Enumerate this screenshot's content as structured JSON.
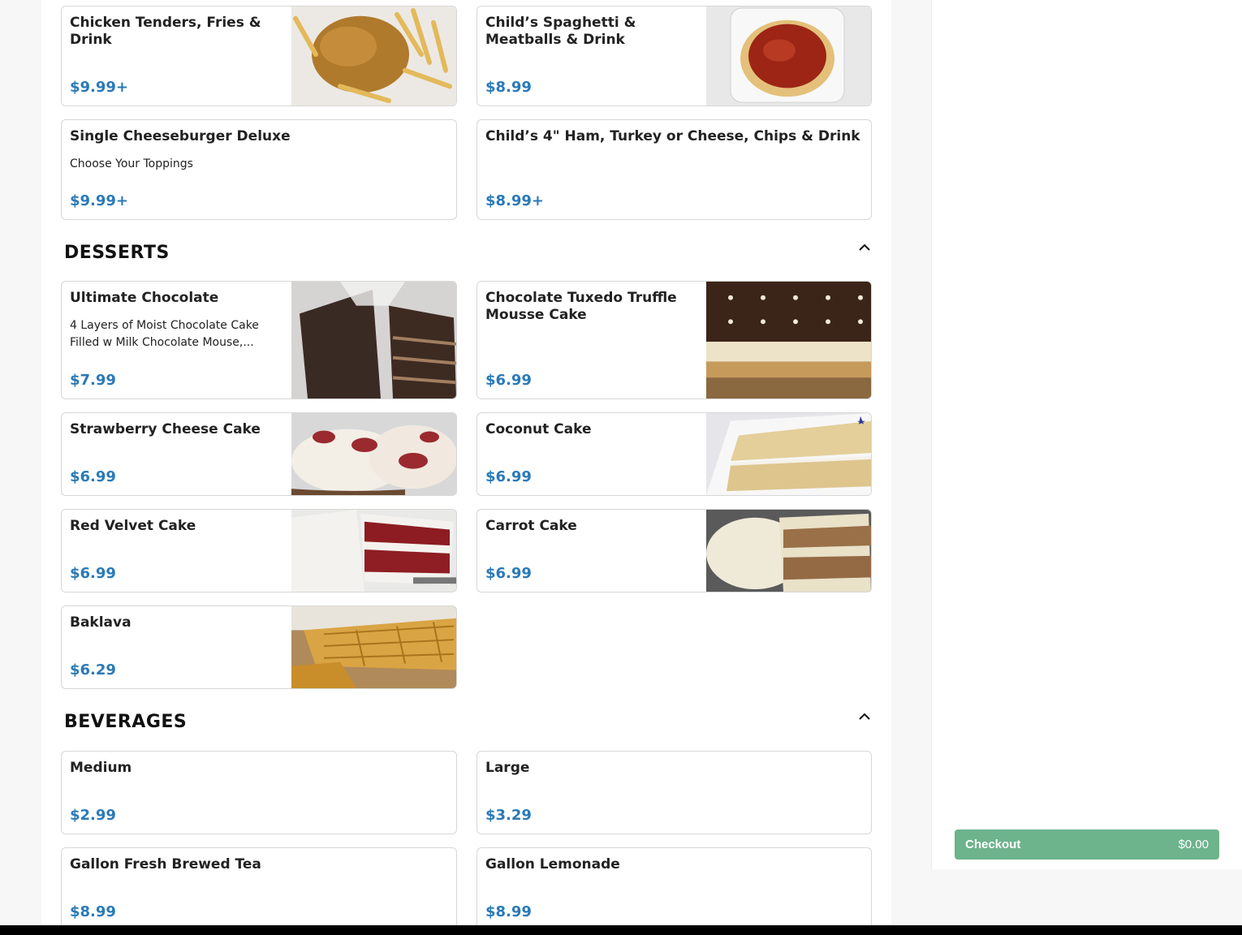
{
  "menu": {
    "kids_items": [
      {
        "name": "Chicken Tenders, Fries & Drink",
        "price": "$9.99+"
      },
      {
        "name": "Child’s Spaghetti & Meatballs & Drink",
        "price": "$8.99"
      },
      {
        "name": "Single Cheeseburger Deluxe",
        "description": "Choose Your Toppings",
        "price": "$9.99+"
      },
      {
        "name": "Child’s 4\" Ham, Turkey or Cheese, Chips & Drink",
        "price": "$8.99+"
      }
    ],
    "desserts": {
      "title": "DESSERTS",
      "items": [
        {
          "name": "Ultimate Chocolate",
          "description": "4 Layers of Moist Chocolate Cake Filled w Milk Chocolate Mouse,...",
          "price": "$7.99"
        },
        {
          "name": "Chocolate Tuxedo Truffle Mousse Cake",
          "price": "$6.99"
        },
        {
          "name": "Strawberry Cheese Cake",
          "price": "$6.99"
        },
        {
          "name": "Coconut Cake",
          "price": "$6.99"
        },
        {
          "name": "Red Velvet Cake",
          "price": "$6.99"
        },
        {
          "name": "Carrot Cake",
          "price": "$6.99"
        },
        {
          "name": "Baklava",
          "price": "$6.29"
        }
      ]
    },
    "beverages": {
      "title": "BEVERAGES",
      "items": [
        {
          "name": "Medium",
          "price": "$2.99"
        },
        {
          "name": "Large",
          "price": "$3.29"
        },
        {
          "name": "Gallon Fresh Brewed Tea",
          "price": "$8.99"
        },
        {
          "name": "Gallon Lemonade",
          "price": "$8.99"
        }
      ]
    }
  },
  "cart": {
    "checkout_label": "Checkout",
    "total": "$0.00"
  },
  "colors": {
    "price": "#2a7ab8",
    "checkout": "#6db38c"
  }
}
